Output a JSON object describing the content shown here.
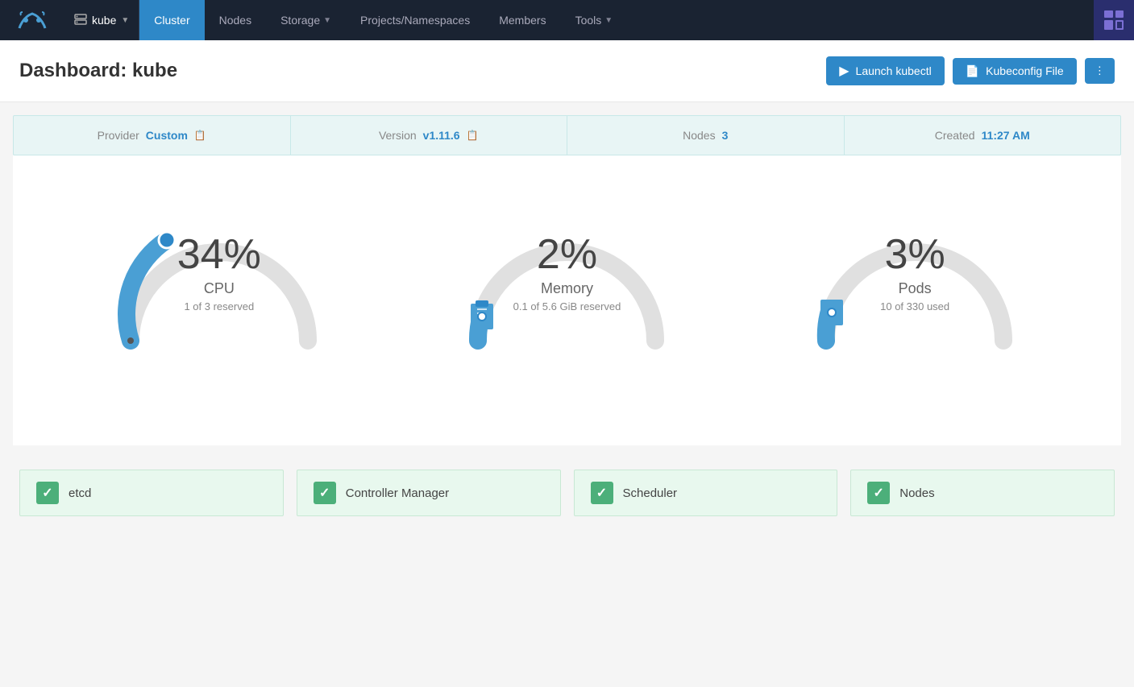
{
  "nav": {
    "logo_alt": "Rancher Logo",
    "cluster_name": "kube",
    "cluster_icon": "server-icon",
    "items": [
      {
        "label": "Cluster",
        "active": true
      },
      {
        "label": "Nodes",
        "active": false
      },
      {
        "label": "Storage",
        "active": false,
        "has_dropdown": true
      },
      {
        "label": "Projects/Namespaces",
        "active": false
      },
      {
        "label": "Members",
        "active": false
      },
      {
        "label": "Tools",
        "active": false,
        "has_dropdown": true
      }
    ],
    "avatar_label": "User Menu"
  },
  "header": {
    "title_prefix": "Dashboard:",
    "title_name": "kube",
    "actions": {
      "launch_kubectl_label": "Launch kubectl",
      "kubeconfig_label": "Kubeconfig File",
      "more_label": "⋮"
    }
  },
  "info_bar": {
    "provider_label": "Provider",
    "provider_value": "Custom",
    "version_label": "Version",
    "version_value": "v1.11.6",
    "nodes_label": "Nodes",
    "nodes_value": "3",
    "created_label": "Created",
    "created_value": "11:27 AM"
  },
  "gauges": [
    {
      "id": "cpu",
      "percent": 34,
      "label": "CPU",
      "sublabel": "1 of 3 reserved",
      "color": "#4a9fd4",
      "track_color": "#e0e0e0",
      "indicator_color": "#2e88c8"
    },
    {
      "id": "memory",
      "percent": 2,
      "label": "Memory",
      "sublabel": "0.1 of 5.6 GiB reserved",
      "color": "#e0e0e0",
      "track_color": "#e0e0e0",
      "indicator_color": "#2e88c8"
    },
    {
      "id": "pods",
      "percent": 3,
      "label": "Pods",
      "sublabel": "10 of 330 used",
      "color": "#e0e0e0",
      "track_color": "#e0e0e0",
      "indicator_color": "#2e88c8"
    }
  ],
  "status_items": [
    {
      "label": "etcd",
      "healthy": true
    },
    {
      "label": "Controller Manager",
      "healthy": true
    },
    {
      "label": "Scheduler",
      "healthy": true
    },
    {
      "label": "Nodes",
      "healthy": true
    }
  ]
}
